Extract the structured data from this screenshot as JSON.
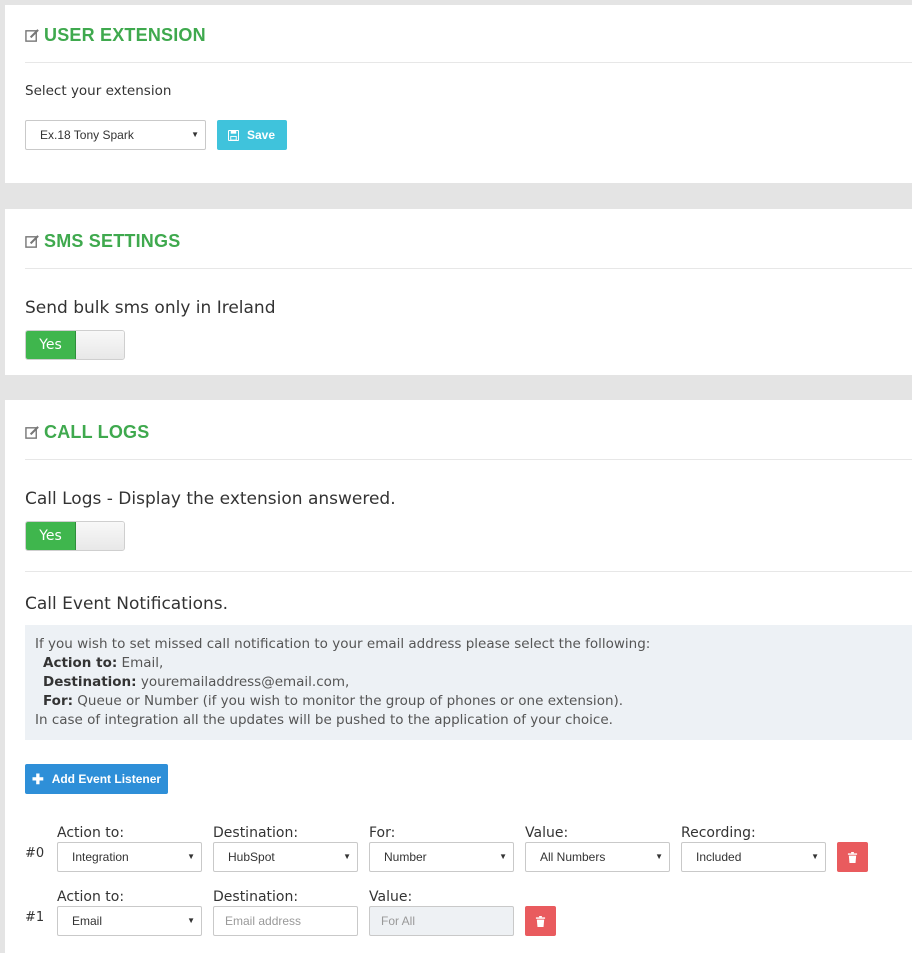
{
  "user_extension": {
    "title": "USER EXTENSION",
    "label": "Select your extension",
    "selected": "Ex.18 Tony Spark",
    "save_label": "Save"
  },
  "sms_settings": {
    "title": "SMS SETTINGS",
    "label": "Send bulk sms only in Ireland",
    "toggle": "Yes"
  },
  "call_logs": {
    "title": "CALL LOGS",
    "label": "Call Logs - Display the extension answered.",
    "toggle": "Yes",
    "notifications_title": "Call Event Notifications.",
    "info": {
      "line1": "If you wish to set missed call notification to your email address please select the following:",
      "action_label": "Action to:",
      "action_value": " Email,",
      "destination_label": "Destination:",
      "destination_value": " youremailaddress@email.com,",
      "for_label": "For:",
      "for_value": " Queue or Number (if you wish to monitor the group of phones or one extension).",
      "line5": "In case of integration all the updates will be pushed to the application of your choice."
    },
    "add_listener_label": "Add Event Listener",
    "listeners": [
      {
        "index": "#0",
        "action_label": "Action to:",
        "action_value": "Integration",
        "destination_label": "Destination:",
        "destination_value": "HubSpot",
        "for_label": "For:",
        "for_value": "Number",
        "value_label": "Value:",
        "value_value": "All Numbers",
        "recording_label": "Recording:",
        "recording_value": "Included"
      },
      {
        "index": "#1",
        "action_label": "Action to:",
        "action_value": "Email",
        "destination_label": "Destination:",
        "destination_placeholder": "Email address",
        "value_label": "Value:",
        "value_placeholder": "For All"
      }
    ]
  },
  "colors": {
    "title_green": "#3fa94e",
    "save_cyan": "#3fc3dc",
    "toggle_green": "#3fb64d",
    "add_blue": "#2e8fd8",
    "delete_red": "#e95b5e",
    "info_bg": "#edf1f5"
  },
  "icons": {
    "section_title": "edit-icon",
    "save": "floppy-disk-icon",
    "add": "plus-icon",
    "delete": "trash-icon"
  }
}
